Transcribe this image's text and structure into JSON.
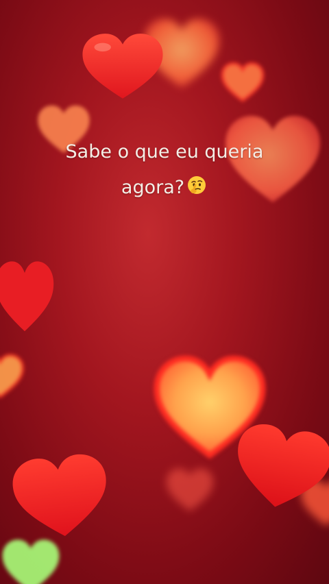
{
  "caption": {
    "line1": "Sabe o que eu queria",
    "line2": "agora?"
  },
  "emoji": {
    "name": "thinking-face-emoji"
  },
  "colors": {
    "background": "#a3161f",
    "heart_red": "#ff2a2a",
    "heart_glow": "#ffb14a",
    "heart_green": "#b8ff7a"
  }
}
